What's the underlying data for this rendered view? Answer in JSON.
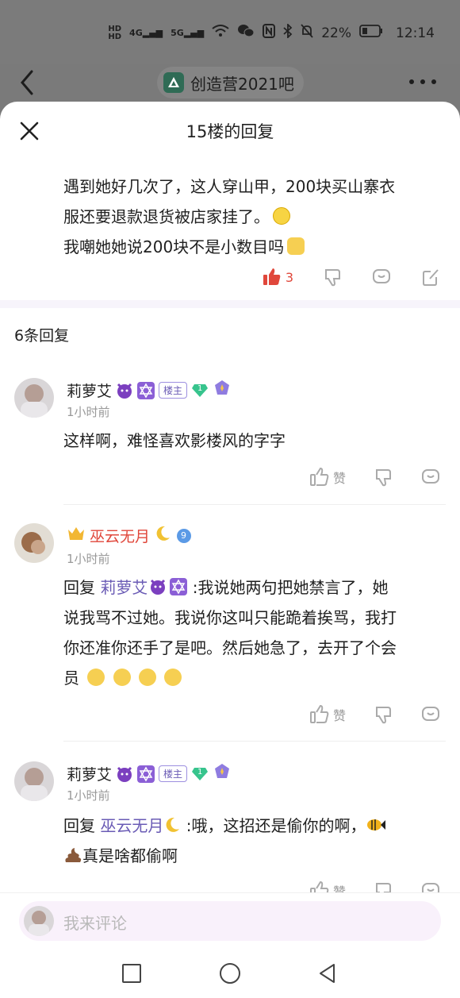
{
  "status": {
    "hd1": "HD",
    "hd2": "HD",
    "net1": "4G",
    "net2": "5G",
    "battery": "22%",
    "time": "12:14"
  },
  "topbar": {
    "forum_name": "创造营2021吧"
  },
  "sheet": {
    "title": "15楼的回复"
  },
  "main_post": {
    "line1": "遇到她好几次了，这人穿山甲，200块买山寨衣",
    "line2": "服还要退款退货被店家挂了。",
    "line3": "我嘲她她说200块不是小数目吗",
    "like_count": "3"
  },
  "replies_header": "6条回复",
  "replies": [
    {
      "username": "莉萝艾",
      "badge": "楼主",
      "gem_level": "1",
      "time": "1小时前",
      "text": "这样啊，难怪喜欢影楼风的字字",
      "like_label": "赞"
    },
    {
      "username": "巫云无月",
      "gem_level": "9",
      "time": "1小时前",
      "reply_prefix": "回复",
      "mention": "莉萝艾",
      "text_a": " :我说她两句把她禁言了，她",
      "text_b": "说我骂不过她。我说你这叫只能跪着挨骂，我打",
      "text_c": "你还准你还手了是吧。然后她急了，去开了个会",
      "text_d": "员",
      "like_label": "赞"
    },
    {
      "username": "莉萝艾",
      "badge": "楼主",
      "gem_level": "1",
      "time": "1小时前",
      "reply_prefix": "回复",
      "mention": "巫云无月",
      "text_a": " :哦，这招还是偷你的啊，",
      "text_b": "真是啥都偷啊",
      "like_label": "赞"
    }
  ],
  "comment_input": {
    "placeholder": "我来评论"
  },
  "colors": {
    "accent": "#6a5bb5",
    "like_red": "#e0473b",
    "sheet_bg": "#ffffff"
  }
}
